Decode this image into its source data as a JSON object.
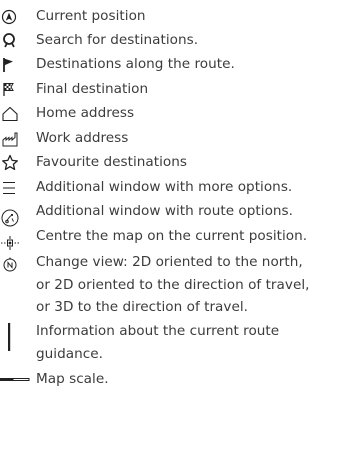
{
  "legend": {
    "items": [
      {
        "icon": "current-position-icon",
        "text": "Current position"
      },
      {
        "icon": "search-icon",
        "text": "Search for destinations."
      },
      {
        "icon": "flag-icon",
        "text": "Destinations along the route."
      },
      {
        "icon": "checkered-flag-icon",
        "text": "Final destination"
      },
      {
        "icon": "home-icon",
        "text": "Home address"
      },
      {
        "icon": "work-icon",
        "text": "Work address"
      },
      {
        "icon": "star-icon",
        "text": "Favourite destinations"
      },
      {
        "icon": "menu-icon",
        "text": "Additional window with more options."
      },
      {
        "icon": "route-options-icon",
        "text": "Additional window with route options."
      },
      {
        "icon": "centre-map-icon",
        "text": "Centre the map on the current position."
      },
      {
        "icon": "compass-north-icon",
        "text": "Change view: 2D oriented to the north,\nor 2D oriented to the direction of travel,\nor 3D to the direction of travel."
      },
      {
        "icon": "route-guidance-bar-icon",
        "text": "Information about the current route\nguidance."
      },
      {
        "icon": "map-scale-icon",
        "text": "Map scale."
      }
    ]
  },
  "colors": {
    "text": "#3c3c3c",
    "icon": "#222222"
  }
}
